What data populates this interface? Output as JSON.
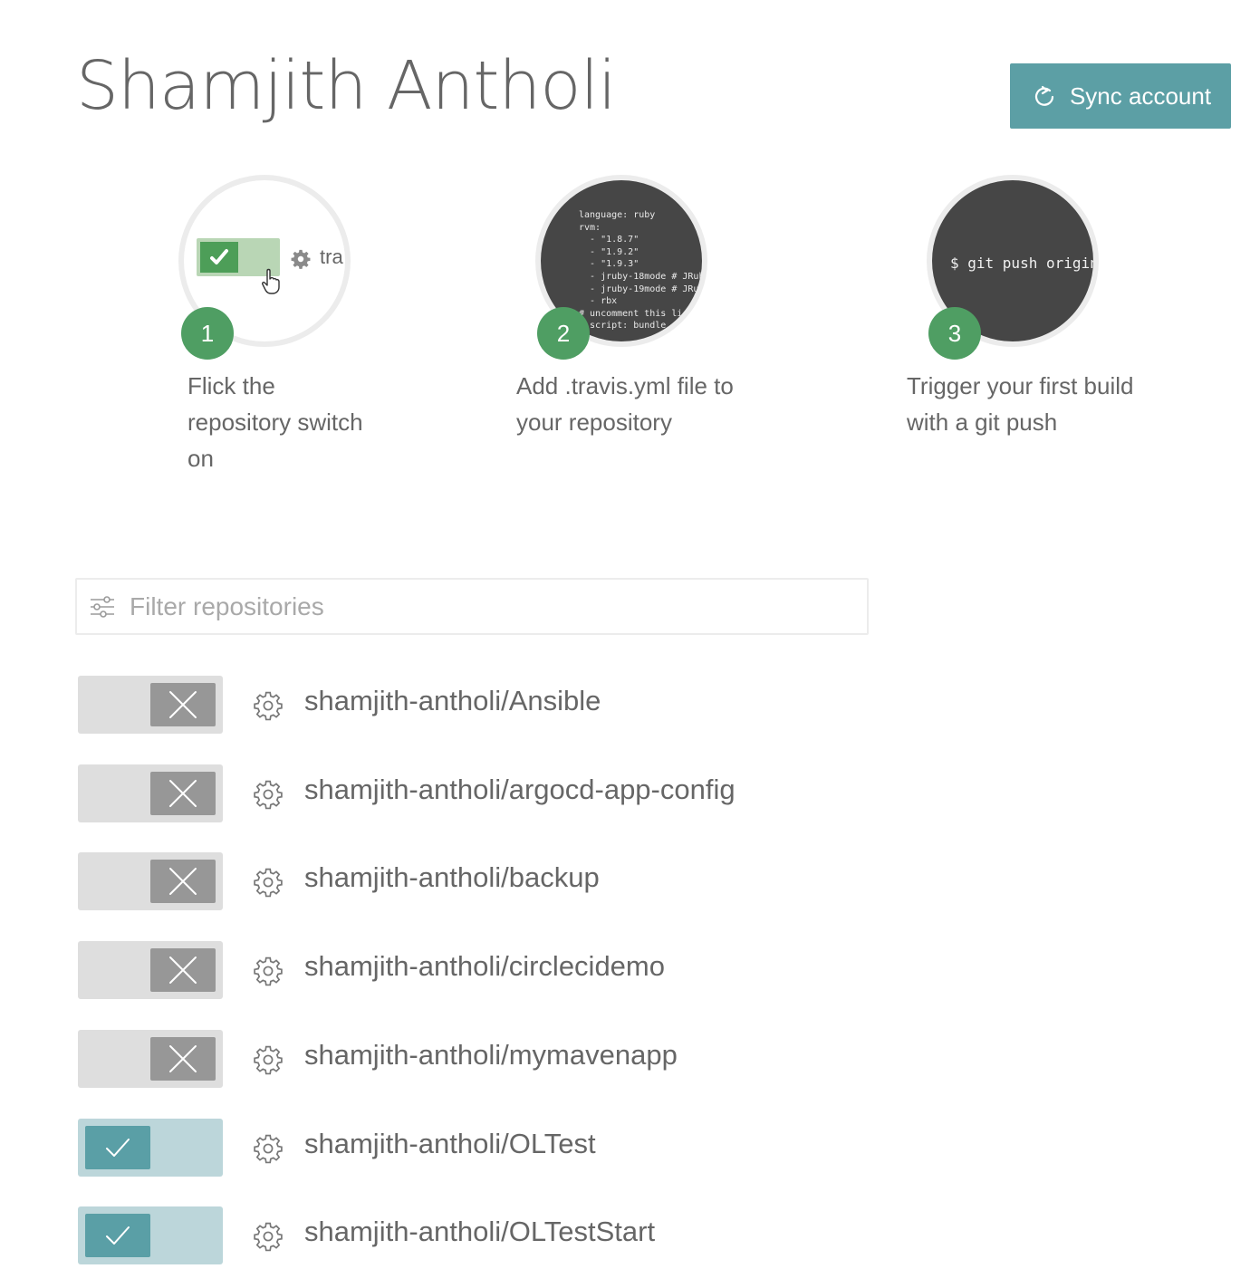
{
  "header": {
    "title": "Shamjith Antholi",
    "sync_label": "Sync account"
  },
  "steps": [
    {
      "number": "1",
      "text_lines": [
        "Flick the",
        "repository switch",
        "on"
      ],
      "demo_text": "tra"
    },
    {
      "number": "2",
      "text_lines": [
        "Add .travis.yml file to",
        "your repository"
      ],
      "code": "language: ruby\nrvm:\n  - \"1.8.7\"\n  - \"1.9.2\"\n  - \"1.9.3\"\n  - jruby-18mode # JRub\n  - jruby-19mode # JRu\n  - rbx\n# uncomment this li\n  script: bundle"
    },
    {
      "number": "3",
      "text_lines": [
        "Trigger your first build",
        "with a git push"
      ],
      "terminal": "$ git push origin"
    }
  ],
  "filter": {
    "placeholder": "Filter repositories",
    "value": ""
  },
  "repositories": [
    {
      "name": "shamjith-antholi/Ansible",
      "active": false
    },
    {
      "name": "shamjith-antholi/argocd-app-config",
      "active": false
    },
    {
      "name": "shamjith-antholi/backup",
      "active": false
    },
    {
      "name": "shamjith-antholi/circlecidemo",
      "active": false
    },
    {
      "name": "shamjith-antholi/mymavenapp",
      "active": false
    },
    {
      "name": "shamjith-antholi/OLTest",
      "active": true
    },
    {
      "name": "shamjith-antholi/OLTestStart",
      "active": true
    }
  ],
  "colors": {
    "accent": "#5c9fa5",
    "step_badge": "#4f9e63",
    "toggle_off_knob": "#979797",
    "toggle_on_knob": "#5a9fa6"
  },
  "icons": {
    "sync": "refresh-icon",
    "filter": "sliders-icon",
    "settings": "gear-icon",
    "toggle_off": "close-icon",
    "toggle_on": "check-icon"
  }
}
